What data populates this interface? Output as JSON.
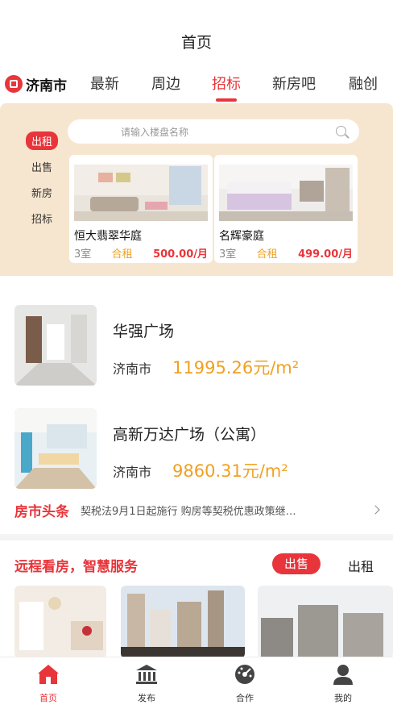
{
  "header": {
    "title": "首页"
  },
  "nav": {
    "city": "济南市",
    "tabs": [
      {
        "label": "最新"
      },
      {
        "label": "周边"
      },
      {
        "label": "招标"
      },
      {
        "label": "新房吧"
      },
      {
        "label": "融创"
      }
    ],
    "active_tab": "招标"
  },
  "promo": {
    "side": [
      {
        "label": "出租"
      },
      {
        "label": "出售"
      },
      {
        "label": "新房"
      },
      {
        "label": "招标"
      }
    ],
    "active_side": "出租",
    "search_placeholder": "请输入楼盘名称",
    "cards": [
      {
        "name": "恒大翡翠华庭",
        "rooms": "3室",
        "type": "合租",
        "price": "500.00/月"
      },
      {
        "name": "名辉豪庭",
        "rooms": "3室",
        "type": "合租",
        "price": "499.00/月"
      }
    ]
  },
  "listings": [
    {
      "name": "华强广场",
      "city": "济南市",
      "price": "11995.26元/m²"
    },
    {
      "name": "高新万达广场（公寓）",
      "city": "济南市",
      "price": "9860.31元/m²"
    }
  ],
  "news": {
    "title": "房市头条",
    "text": "契税法9月1日起施行 购房等契税优惠政策继…"
  },
  "remote": {
    "title": "远程看房，智慧服务",
    "sale": "出售",
    "rent": "出租"
  },
  "tabbar": [
    {
      "label": "首页",
      "icon": "home-icon"
    },
    {
      "label": "发布",
      "icon": "publish-icon"
    },
    {
      "label": "合作",
      "icon": "cooperate-icon"
    },
    {
      "label": "我的",
      "icon": "profile-icon"
    }
  ],
  "colors": {
    "accent": "#e8353b",
    "price": "#f0a020",
    "promo_bg": "#f7e6cf"
  }
}
